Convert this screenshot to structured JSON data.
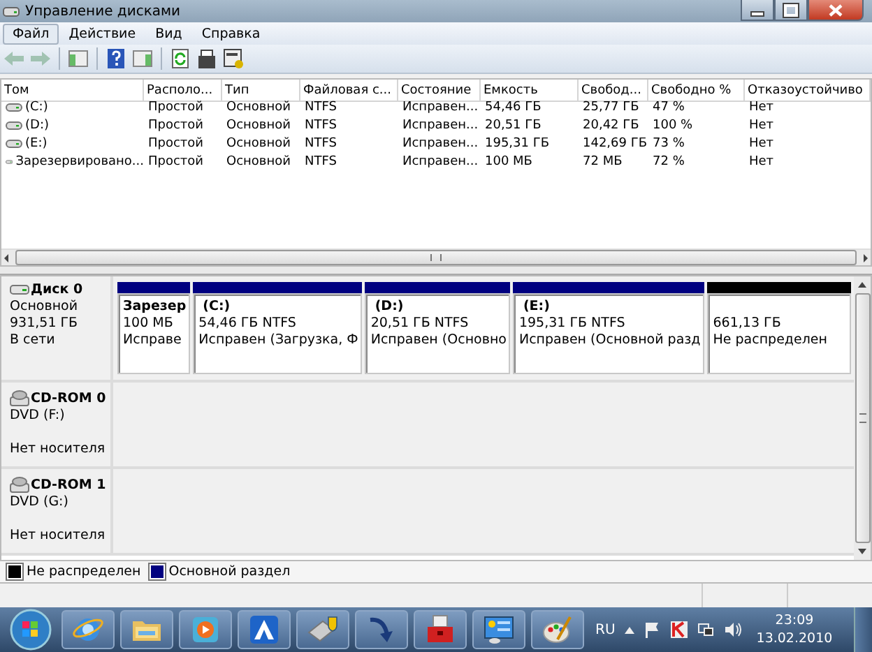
{
  "window": {
    "title": "Управление дисками"
  },
  "menu": [
    {
      "label": "Файл",
      "selected": true
    },
    {
      "label": "Действие",
      "selected": false
    },
    {
      "label": "Вид",
      "selected": false
    },
    {
      "label": "Справка",
      "selected": false
    }
  ],
  "toolbar": [
    {
      "kind": "back",
      "disabled": true
    },
    {
      "kind": "forward",
      "disabled": true
    },
    {
      "kind": "sep"
    },
    {
      "kind": "tree"
    },
    {
      "kind": "sep"
    },
    {
      "kind": "help"
    },
    {
      "kind": "pane"
    },
    {
      "kind": "sep"
    },
    {
      "kind": "refresh"
    },
    {
      "kind": "props"
    },
    {
      "kind": "settings"
    }
  ],
  "volume_table": {
    "columns": [
      "Том",
      "Располо...",
      "Тип",
      "Файловая с...",
      "Состояние",
      "Емкость",
      "Свобод...",
      "Свободно %",
      "Отказоустойчиво"
    ],
    "rows": [
      {
        "cells": [
          "(C:)",
          "Простой",
          "Основной",
          "NTFS",
          "Исправен...",
          "54,46 ГБ",
          "25,77 ГБ",
          "47 %",
          "Нет"
        ]
      },
      {
        "cells": [
          "(D:)",
          "Простой",
          "Основной",
          "NTFS",
          "Исправен...",
          "20,51 ГБ",
          "20,42 ГБ",
          "100 %",
          "Нет"
        ]
      },
      {
        "cells": [
          "(E:)",
          "Простой",
          "Основной",
          "NTFS",
          "Исправен...",
          "195,31 ГБ",
          "142,69 ГБ",
          "73 %",
          "Нет"
        ]
      },
      {
        "cells": [
          "Зарезервировано...",
          "Простой",
          "Основной",
          "NTFS",
          "Исправен...",
          "100 МБ",
          "72 МБ",
          "72 %",
          "Нет"
        ]
      }
    ]
  },
  "disks": [
    {
      "kind": "hdd",
      "name": "Диск 0",
      "lines": [
        "Основной",
        "931,51 ГБ",
        "В сети"
      ],
      "partitions": [
        {
          "kind": "primary",
          "label": "Зарезер",
          "size": "100 МБ",
          "status": "Исправе"
        },
        {
          "kind": "primary",
          "label": "(C:)",
          "size": "54,46 ГБ NTFS",
          "status": "Исправен (Загрузка, Ф"
        },
        {
          "kind": "primary",
          "label": "(D:)",
          "size": "20,51 ГБ NTFS",
          "status": "Исправен (Основно"
        },
        {
          "kind": "primary",
          "label": "(E:)",
          "size": "195,31 ГБ NTFS",
          "status": "Исправен (Основной разд"
        },
        {
          "kind": "unallocated",
          "size": "661,13 ГБ",
          "status": "Не распределен"
        }
      ]
    },
    {
      "kind": "cdrom",
      "name": "CD-ROM 0",
      "lines": [
        "DVD (F:)",
        "Нет носителя"
      ]
    },
    {
      "kind": "cdrom",
      "name": "CD-ROM 1",
      "lines": [
        "DVD (G:)",
        "Нет носителя"
      ]
    }
  ],
  "legend": [
    {
      "label": "Не распределен",
      "color": "#000000"
    },
    {
      "label": "Основной раздел",
      "color": "#000080"
    }
  ],
  "taskbar": {
    "language": "RU",
    "time": "23:09",
    "date": "13.02.2010"
  }
}
